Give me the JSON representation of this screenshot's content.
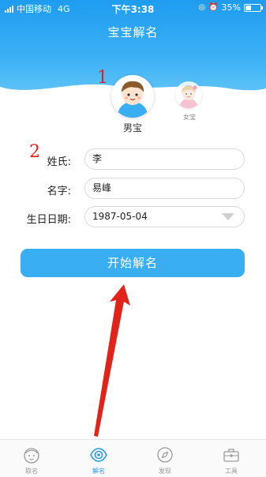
{
  "status_bar": {
    "carrier": "中国移动",
    "network": "4G",
    "time": "下午3:38",
    "battery": "35%"
  },
  "header": {
    "title": "宝宝解名"
  },
  "annotations": {
    "marker_1": "1",
    "marker_2": "2"
  },
  "gender": {
    "boy_label": "男宝",
    "girl_label": "女宝",
    "selected": "男宝"
  },
  "form": {
    "surname_label": "姓氏:",
    "surname_value": "李",
    "given_name_label": "名字:",
    "given_name_value": "易峰",
    "birthday_label": "生日日期:",
    "birthday_value": "1987-05-04"
  },
  "start_button": "开始解名",
  "tabs": [
    {
      "label": "取名",
      "icon": "baby-face-icon",
      "active": false
    },
    {
      "label": "解名",
      "icon": "eye-icon",
      "active": true
    },
    {
      "label": "发现",
      "icon": "compass-icon",
      "active": false
    },
    {
      "label": "工具",
      "icon": "toolbox-icon",
      "active": false
    }
  ],
  "colors": {
    "primary": "#3aaef3",
    "header_top": "#1e9cf0",
    "annotation_red": "#e2231a",
    "tab_active": "#2a9be8"
  }
}
